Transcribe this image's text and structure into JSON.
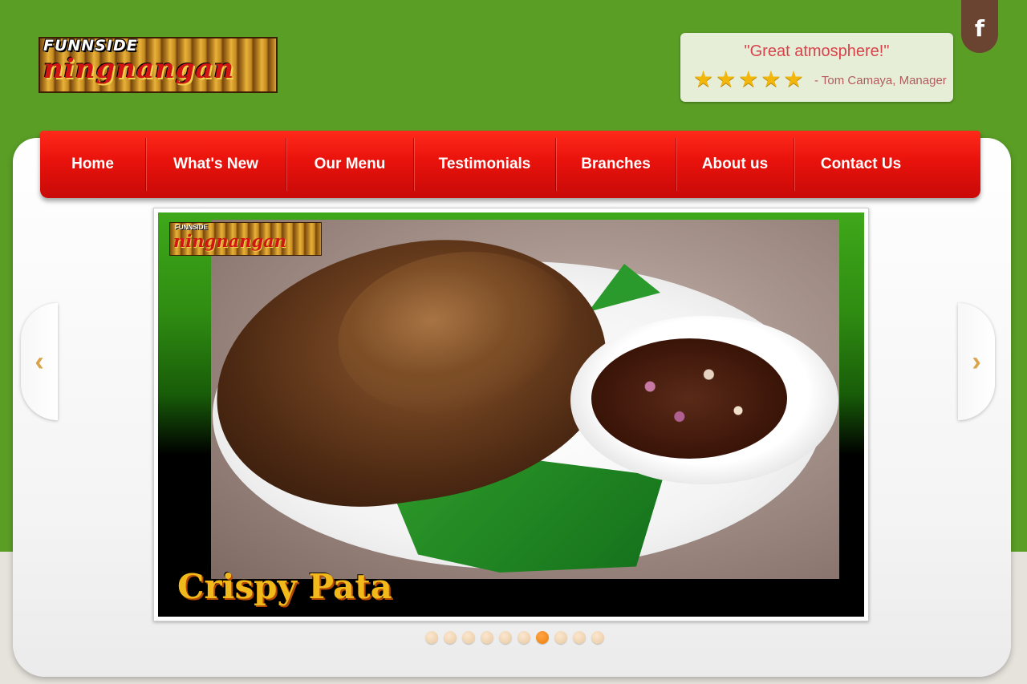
{
  "brand": {
    "logo_top": "FUNNSIDE",
    "logo_main": "ningnangan"
  },
  "testimonial": {
    "quote": "\"Great atmosphere!\"",
    "rating": 5,
    "stars": [
      "★",
      "★",
      "★",
      "★",
      "★"
    ],
    "author": "- Tom Camaya, Manager"
  },
  "social": {
    "facebook_label": "f"
  },
  "nav": {
    "items": [
      {
        "label": "Home"
      },
      {
        "label": "What's New"
      },
      {
        "label": "Our Menu"
      },
      {
        "label": "Testimonials"
      },
      {
        "label": "Branches"
      },
      {
        "label": "About us"
      },
      {
        "label": "Contact Us"
      }
    ]
  },
  "slideshow": {
    "caption": "Crispy Pata",
    "watermark_top": "FUNNSIDE",
    "watermark_main": "ningnangan",
    "prev_label": "‹",
    "next_label": "›",
    "total_slides": 10,
    "active_slide": 7
  },
  "colors": {
    "page_green": "#5a9e26",
    "nav_red": "#e8120c",
    "active_dot": "#ee7d08",
    "star_gold": "#f3b60c"
  }
}
